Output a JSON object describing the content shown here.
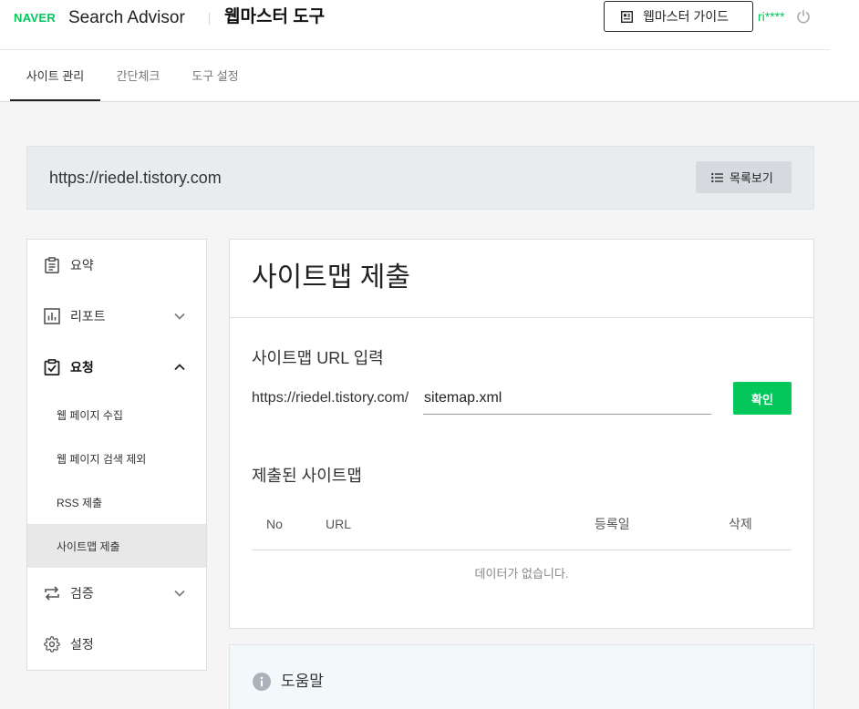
{
  "header": {
    "logo": "NAVER",
    "product": "Search Advisor",
    "tool": "웹마스터 도구",
    "guide_button": "웹마스터 가이드",
    "user": "ri****",
    "guide_icon": "guide-book-icon",
    "logout_icon": "power-icon"
  },
  "tabs": [
    {
      "label": "사이트 관리",
      "active": true
    },
    {
      "label": "간단체크",
      "active": false
    },
    {
      "label": "도구 설정",
      "active": false
    }
  ],
  "site_bar": {
    "url": "https://riedel.tistory.com",
    "list_button": "목록보기",
    "list_icon": "list-icon"
  },
  "sidebar": {
    "items": [
      {
        "label": "요약",
        "icon": "clipboard-icon"
      },
      {
        "label": "리포트",
        "icon": "bar-chart-icon",
        "expanded": false
      },
      {
        "label": "요청",
        "icon": "clipboard-check-icon",
        "expanded": true,
        "children": [
          {
            "label": "웹 페이지 수집",
            "active": false
          },
          {
            "label": "웹 페이지 검색 제외",
            "active": false
          },
          {
            "label": "RSS 제출",
            "active": false
          },
          {
            "label": "사이트맵 제출",
            "active": true
          }
        ]
      },
      {
        "label": "검증",
        "icon": "swap-arrows-icon",
        "expanded": false
      },
      {
        "label": "설정",
        "icon": "gear-icon"
      }
    ]
  },
  "main": {
    "title": "사이트맵 제출",
    "url_section": {
      "heading": "사이트맵 URL 입력",
      "prefix": "https://riedel.tistory.com/",
      "input_value": "sitemap.xml",
      "submit_button": "확인"
    },
    "submitted_section": {
      "heading": "제출된 사이트맵",
      "columns": [
        "No",
        "URL",
        "등록일",
        "삭제"
      ],
      "rows": [],
      "empty_message": "데이터가 없습니다."
    }
  },
  "help": {
    "title": "도움말",
    "icon": "info-icon"
  },
  "colors": {
    "brand_green": "#03c75a",
    "page_background": "#f5f5f5",
    "site_bar_background": "#e9ecef",
    "help_background": "#f3f8fa",
    "active_menu_background": "#e8e8e8"
  }
}
